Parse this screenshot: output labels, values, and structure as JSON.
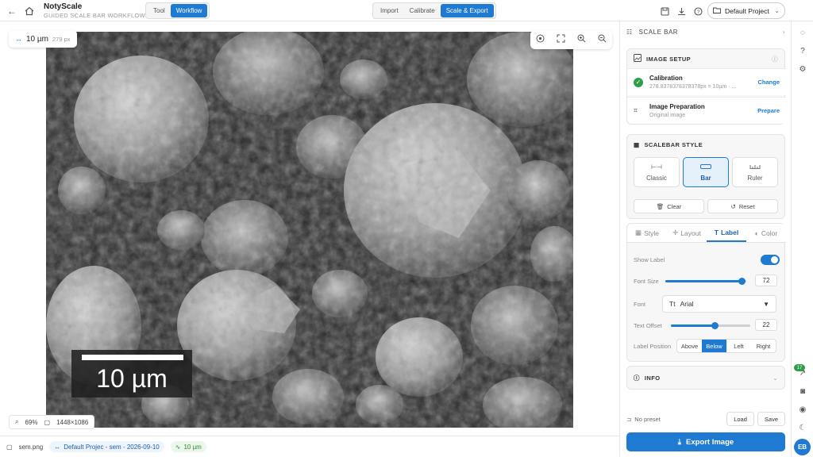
{
  "app": {
    "title": "NotyScale",
    "subtitle": "GUIDED SCALE BAR WORKFLOW",
    "mode_tabs": [
      {
        "label": "Tool"
      },
      {
        "label": "Workflow"
      }
    ],
    "step_tabs": [
      {
        "label": "Import"
      },
      {
        "label": "Calibrate"
      },
      {
        "label": "Scale & Export"
      }
    ],
    "project": "Default Project"
  },
  "canvas": {
    "scale_chip": {
      "value": "10 µm",
      "px": "279 px"
    },
    "overlay_label": "10 µm",
    "zoom": "69%",
    "dimensions": "1448×1086"
  },
  "statusbar": {
    "file": "sem.png",
    "project_info": "Default Projec - sem - 2026-09-10",
    "scale": "10 µm"
  },
  "panel": {
    "header": "SCALE BAR",
    "image_setup": {
      "title": "IMAGE SETUP",
      "calibration_label": "Calibration",
      "calibration_value": "278.8378378378378px = 10µm · ...",
      "calibration_action": "Change",
      "prep_label": "Image Preparation",
      "prep_value": "Original image",
      "prep_action": "Prepare"
    },
    "scalebar_style": {
      "title": "SCALEBAR STYLE",
      "options": [
        {
          "label": "Classic"
        },
        {
          "label": "Bar"
        },
        {
          "label": "Ruler"
        }
      ],
      "clear": "Clear",
      "reset": "Reset"
    },
    "tabs": [
      {
        "label": "Style"
      },
      {
        "label": "Layout"
      },
      {
        "label": "Label"
      },
      {
        "label": "Color"
      }
    ],
    "label_settings": {
      "show_label": "Show Label",
      "show_label_on": true,
      "font_size_label": "Font Size",
      "font_size": "72",
      "font_size_fraction": 0.95,
      "font_label": "Font",
      "font_value": "Arial",
      "text_offset_label": "Text Offset",
      "text_offset": "22",
      "text_offset_fraction": 0.55,
      "label_position_label": "Label Position",
      "positions": [
        {
          "label": "Above"
        },
        {
          "label": "Below"
        },
        {
          "label": "Left"
        },
        {
          "label": "Right"
        }
      ]
    },
    "info_title": "INFO",
    "preset": {
      "label": "No preset",
      "load": "Load",
      "save": "Save"
    },
    "export": "Export Image"
  },
  "rail": {
    "badge": "17",
    "avatar": "EB"
  },
  "colors": {
    "accent": "#1f7ad1",
    "success": "#2e9e4a"
  }
}
